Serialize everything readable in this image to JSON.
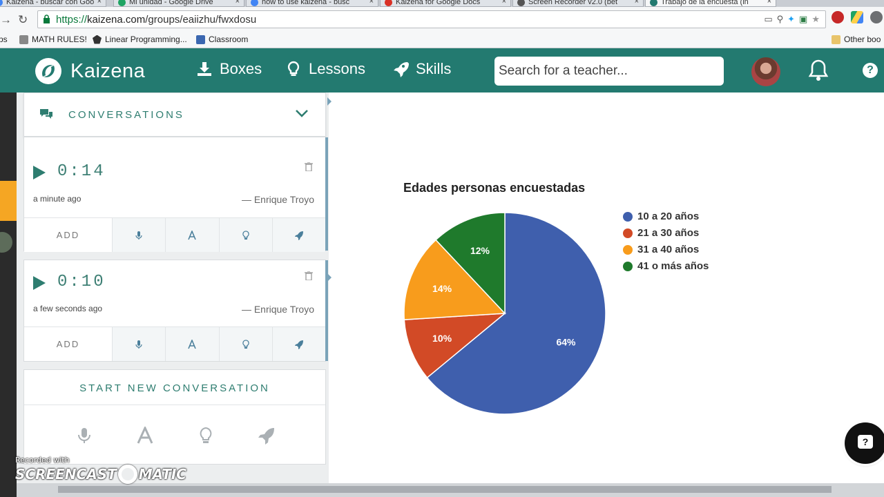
{
  "browser": {
    "tabs": [
      {
        "title": "Kaizena - buscar con Goo",
        "color": "#4285f4"
      },
      {
        "title": "Mi unidad - Google Drive",
        "color": "#1fa463"
      },
      {
        "title": "how to use kaizena - busc",
        "color": "#4285f4"
      },
      {
        "title": "Kaizena for Google Docs",
        "color": "#d93025"
      },
      {
        "title": "Screen Recorder v2.0 (bet",
        "color": "#555555"
      },
      {
        "title": "Trabajo de la encuesta (in",
        "color": "#237a70"
      }
    ],
    "url_scheme": "https://",
    "url_host": "kaizena.com",
    "url_path": "/groups/eaiizhu/fwxdosu",
    "bookmarks": [
      {
        "label": "ps"
      },
      {
        "label": "MATH RULES!"
      },
      {
        "label": "Linear Programming..."
      },
      {
        "label": "Classroom"
      }
    ],
    "other_bookmarks": "Other boo"
  },
  "header": {
    "brand": "Kaizena",
    "nav": [
      {
        "label": "Boxes",
        "icon": "download-icon"
      },
      {
        "label": "Lessons",
        "icon": "lightbulb-icon"
      },
      {
        "label": "Skills",
        "icon": "rocket-icon"
      }
    ],
    "search_placeholder": "Search for a teacher...",
    "help": "?"
  },
  "sidebar": {
    "section_title": "CONVERSATIONS",
    "conversations": [
      {
        "duration": "0:14",
        "when": "a minute ago",
        "author": "— Enrique Troyo",
        "add_label": "ADD"
      },
      {
        "duration": "0:10",
        "when": "a few seconds ago",
        "author": "— Enrique Troyo",
        "add_label": "ADD"
      }
    ],
    "new_conversation": "START NEW CONVERSATION"
  },
  "chart_data": {
    "type": "pie",
    "title": "Edades personas encuestadas",
    "categories": [
      "10 a 20 años",
      "21 a 30 años",
      "31 a 40 años",
      "41 o más años"
    ],
    "values": [
      64,
      10,
      14,
      12
    ],
    "labels": [
      "64%",
      "10%",
      "14%",
      "12%"
    ],
    "colors": [
      "#3f5fad",
      "#d24a26",
      "#f89c1c",
      "#1f7a2c"
    ],
    "legend": "right"
  },
  "overlays": {
    "chat_help": "?",
    "watermark_small": "Recorded with",
    "watermark_big_left": "SCREENCAST",
    "watermark_big_right": "MATIC"
  }
}
